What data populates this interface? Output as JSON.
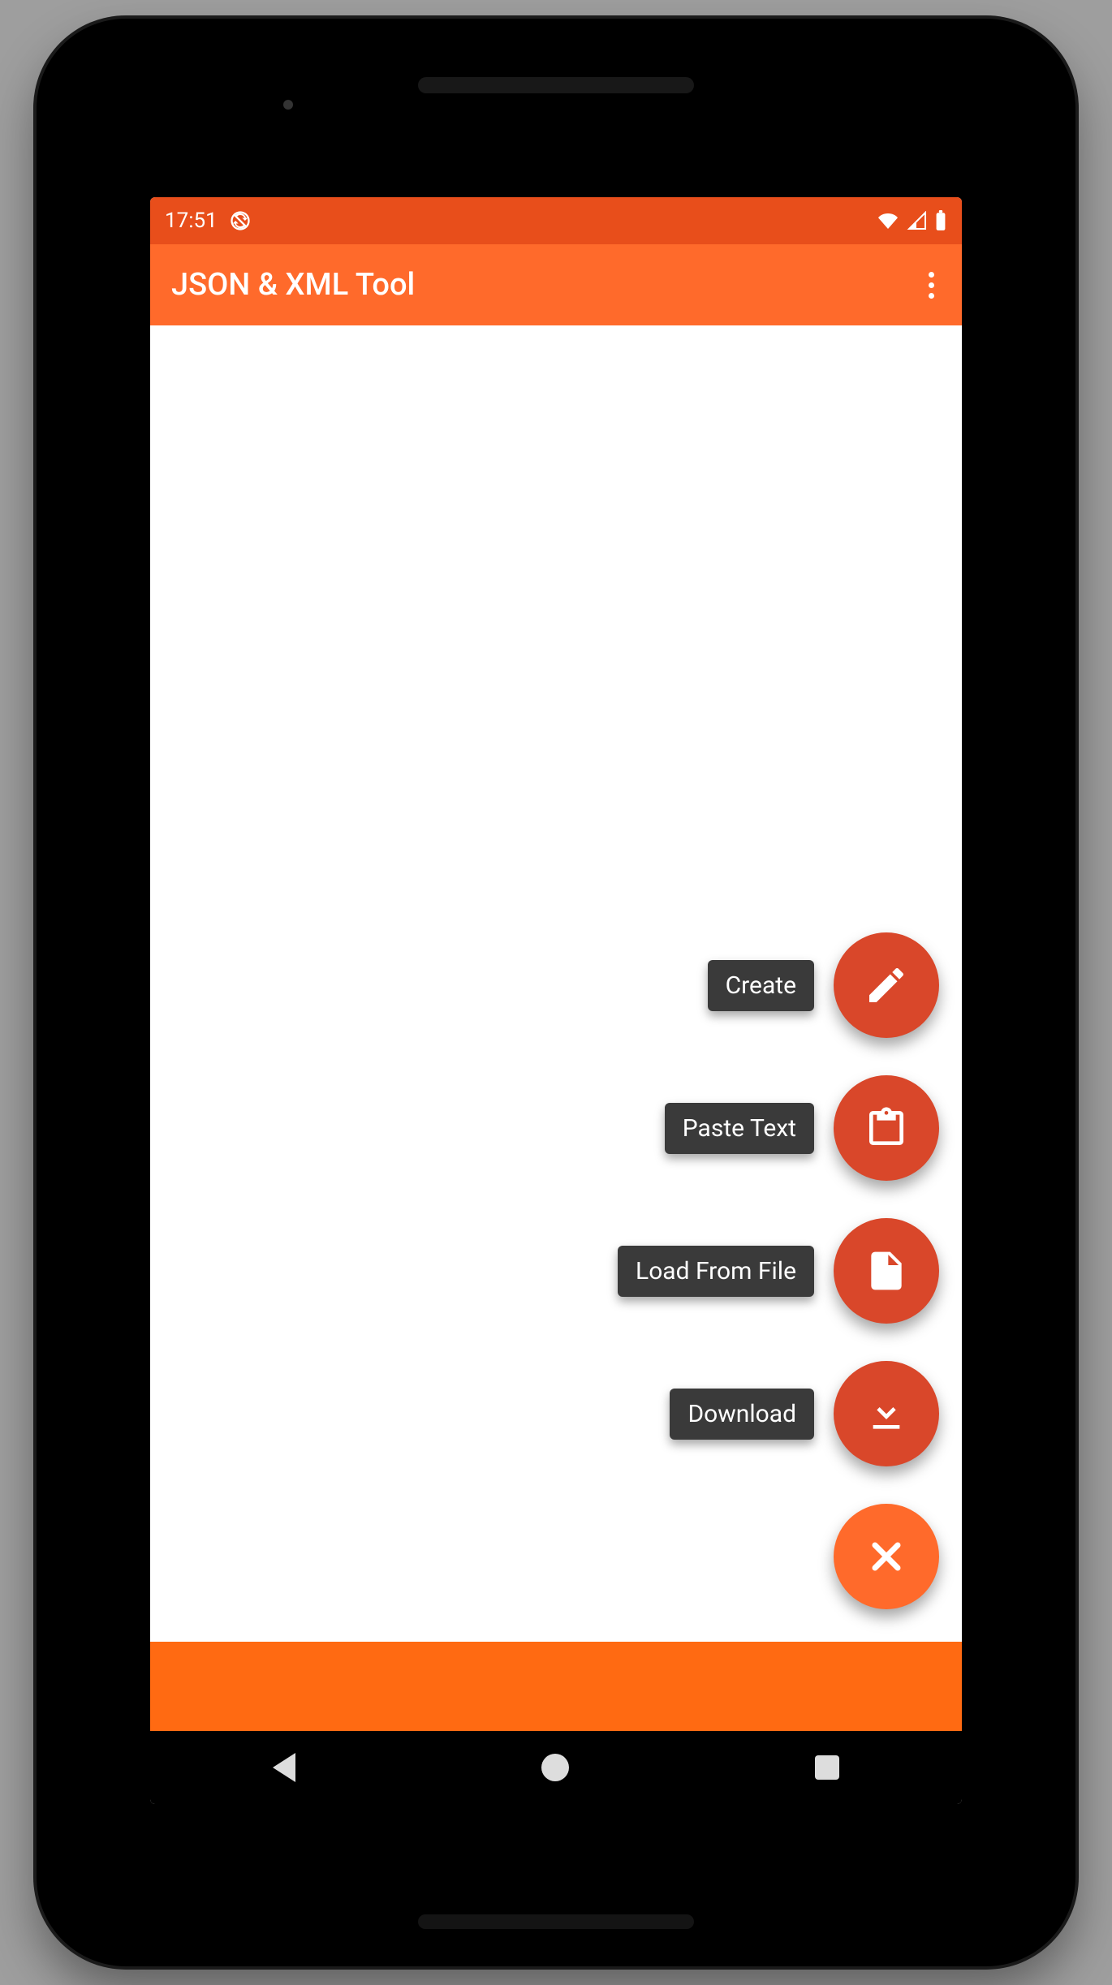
{
  "status": {
    "time": "17:51"
  },
  "appbar": {
    "title": "JSON & XML Tool"
  },
  "fab": {
    "create": "Create",
    "paste": "Paste Text",
    "load": "Load From File",
    "download": "Download"
  },
  "colors": {
    "accent": "#ff6a2b",
    "accent_dark": "#e84e1b",
    "fab": "#d9472a",
    "chip": "#3a3a3a"
  }
}
